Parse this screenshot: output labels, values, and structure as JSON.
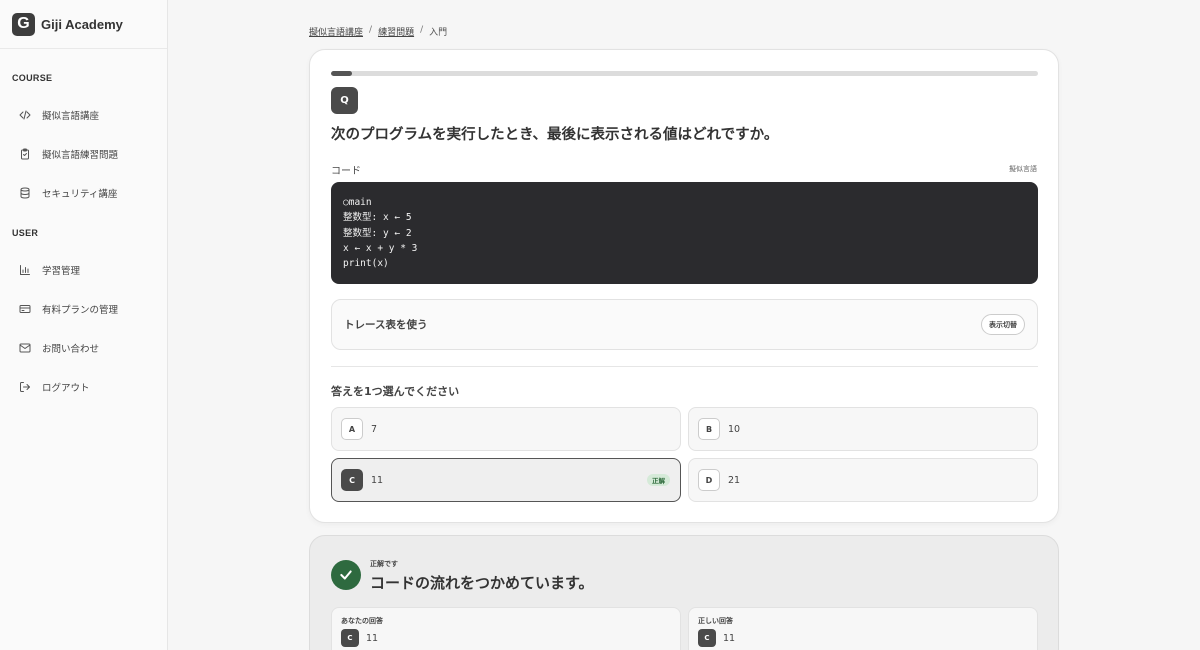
{
  "brand": {
    "logo_letter": "G",
    "name": "Giji Academy"
  },
  "sidebar": {
    "course_heading": "COURSE",
    "course_items": [
      {
        "label": "擬似言語講座",
        "icon": "code-icon"
      },
      {
        "label": "擬似言語練習問題",
        "icon": "clipboard-check-icon"
      },
      {
        "label": "セキュリティ講座",
        "icon": "database-icon"
      }
    ],
    "user_heading": "USER",
    "user_items": [
      {
        "label": "学習管理",
        "icon": "bar-chart-icon"
      },
      {
        "label": "有料プランの管理",
        "icon": "credit-card-icon"
      },
      {
        "label": "お問い合わせ",
        "icon": "mail-icon"
      },
      {
        "label": "ログアウト",
        "icon": "logout-icon"
      }
    ]
  },
  "breadcrumb": {
    "items": [
      "擬似言語講座",
      "練習問題"
    ],
    "current": "入門",
    "separator": "/"
  },
  "question": {
    "progress": 0.03,
    "badge": "Q",
    "text": "次のプログラムを実行したとき、最後に表示される値はどれですか。",
    "code_label": "コード",
    "code_language": "擬似言語",
    "code_lines": [
      "○main",
      "整数型: x ← 5",
      "整数型: y ← 2",
      "x ← x + y * 3",
      "print(x)"
    ],
    "trace_title": "トレース表を使う",
    "trace_toggle": "表示切替",
    "answer_prompt": "答えを1つ選んでください",
    "options": [
      {
        "letter": "A",
        "value": "7"
      },
      {
        "letter": "B",
        "value": "10"
      },
      {
        "letter": "C",
        "value": "11"
      },
      {
        "letter": "D",
        "value": "21"
      }
    ],
    "selected": "C",
    "correct_tag": "正解"
  },
  "result": {
    "status": "正解です",
    "message": "コードの流れをつかめています。",
    "your_answer_label": "あなたの回答",
    "your_answer_letter": "C",
    "your_answer_value": "11",
    "correct_answer_label": "正しい回答",
    "correct_answer_letter": "C",
    "correct_answer_value": "11"
  },
  "colors": {
    "accent": "#4a4a4a",
    "success": "#2e6a3f",
    "code_bg": "#2b2b2e"
  }
}
